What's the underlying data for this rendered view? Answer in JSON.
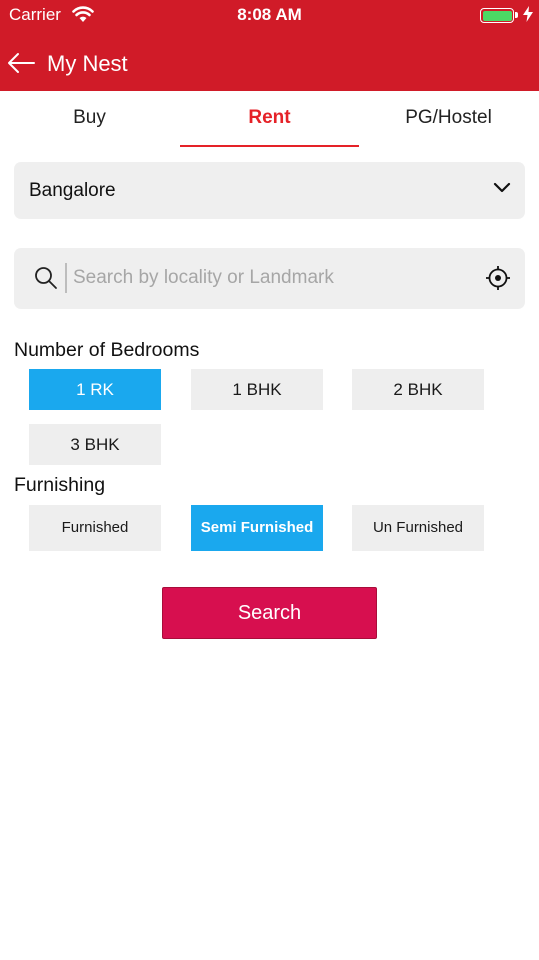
{
  "status_bar": {
    "carrier": "Carrier",
    "time": "8:08 AM",
    "battery_level": 1.0
  },
  "nav": {
    "title": "My Nest",
    "back_icon": "arrow-left-icon"
  },
  "tabs": [
    {
      "label": "Buy",
      "active": false
    },
    {
      "label": "Rent",
      "active": true
    },
    {
      "label": "PG/Hostel",
      "active": false
    }
  ],
  "city_select": {
    "value": "Bangalore",
    "icon": "chevron-down-icon"
  },
  "search": {
    "placeholder": "Search by locality or Landmark",
    "value": "",
    "icon": "search-icon",
    "locate_icon": "crosshair-icon"
  },
  "bedrooms": {
    "label": "Number of Bedrooms",
    "options": [
      {
        "label": "1 RK",
        "selected": true
      },
      {
        "label": "1 BHK",
        "selected": false
      },
      {
        "label": "2 BHK",
        "selected": false
      },
      {
        "label": "3 BHK",
        "selected": false
      }
    ]
  },
  "furnishing": {
    "label": "Furnishing",
    "options": [
      {
        "label": "Furnished",
        "selected": false
      },
      {
        "label": "Semi Furnished",
        "selected": true
      },
      {
        "label": "Un Furnished",
        "selected": false
      }
    ]
  },
  "search_button": {
    "label": "Search"
  },
  "colors": {
    "header": "#d01b28",
    "accent_tab": "#e52228",
    "chip_selected": "#1aa8ee",
    "search_button": "#d70f4f"
  }
}
